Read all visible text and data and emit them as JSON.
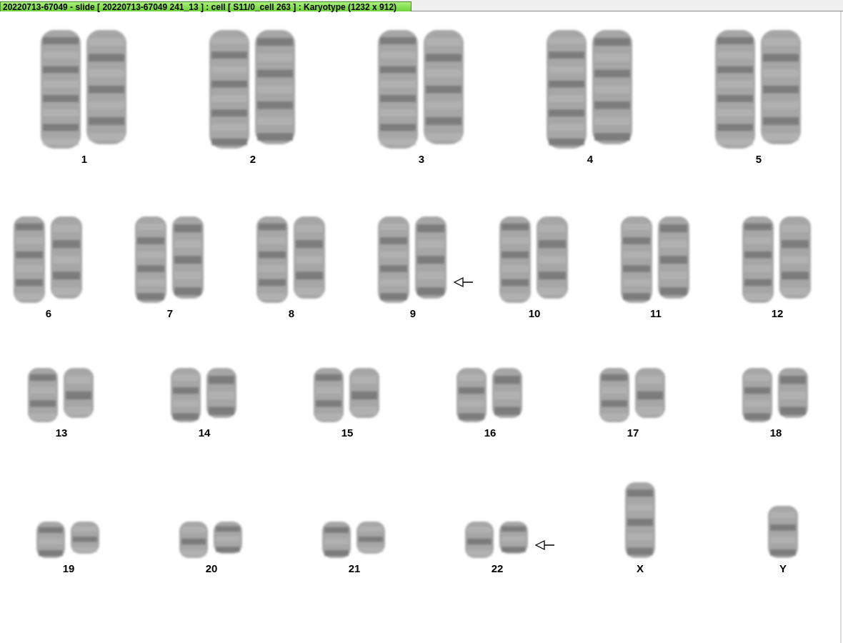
{
  "window": {
    "title": "20220713-67049 - slide [ 20220713-67049 241_13 ] : cell [ S11/0_cell 263 ] : Karyotype  (1232 x 912)"
  },
  "rows": [
    [
      {
        "label": "1",
        "kind": "pair",
        "marked": false
      },
      {
        "label": "2",
        "kind": "pair",
        "marked": false
      },
      {
        "label": "3",
        "kind": "pair",
        "marked": false
      },
      {
        "label": "4",
        "kind": "pair",
        "marked": false
      },
      {
        "label": "5",
        "kind": "pair",
        "marked": false
      }
    ],
    [
      {
        "label": "6",
        "kind": "pair",
        "marked": false
      },
      {
        "label": "7",
        "kind": "pair",
        "marked": false
      },
      {
        "label": "8",
        "kind": "pair",
        "marked": false
      },
      {
        "label": "9",
        "kind": "pair",
        "marked": true
      },
      {
        "label": "10",
        "kind": "pair",
        "marked": false
      },
      {
        "label": "11",
        "kind": "pair",
        "marked": false
      },
      {
        "label": "12",
        "kind": "pair",
        "marked": false
      }
    ],
    [
      {
        "label": "13",
        "kind": "pair",
        "marked": false
      },
      {
        "label": "14",
        "kind": "pair",
        "marked": false
      },
      {
        "label": "15",
        "kind": "pair",
        "marked": false
      },
      {
        "label": "16",
        "kind": "pair",
        "marked": false
      },
      {
        "label": "17",
        "kind": "pair",
        "marked": false
      },
      {
        "label": "18",
        "kind": "pair",
        "marked": false
      }
    ],
    [
      {
        "label": "19",
        "kind": "pair",
        "marked": false
      },
      {
        "label": "20",
        "kind": "pair",
        "marked": false
      },
      {
        "label": "21",
        "kind": "pair",
        "marked": false
      },
      {
        "label": "22",
        "kind": "pair",
        "marked": true
      },
      {
        "label": "X",
        "kind": "single",
        "marked": false
      },
      {
        "label": "Y",
        "kind": "single",
        "marked": false
      }
    ]
  ]
}
